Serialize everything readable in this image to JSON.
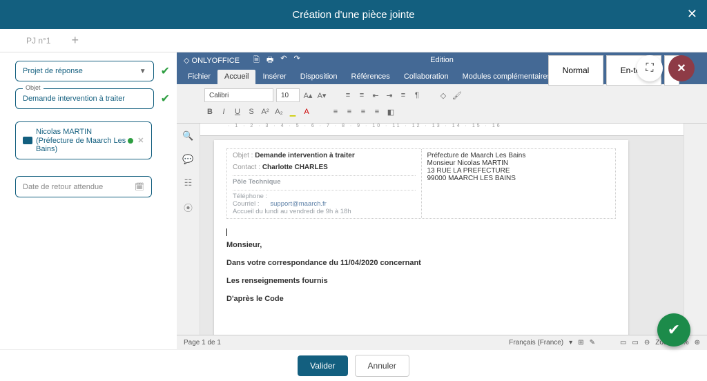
{
  "modal": {
    "title": "Création d'une pièce jointe"
  },
  "tabs": {
    "first": "PJ n°1"
  },
  "fields": {
    "type": "Projet de réponse",
    "object_label": "Objet",
    "object_value": "Demande intervention à traiter",
    "date_placeholder": "Date de retour attendue"
  },
  "contact": {
    "name": "Nicolas MARTIN",
    "org_prefix": "(Préfecture de Maarch Les",
    "org_suffix": "Bains)"
  },
  "onlyoffice": {
    "brand": "ONLYOFFICE",
    "center": "Edition",
    "menu": {
      "fichier": "Fichier",
      "accueil": "Accueil",
      "inserer": "Insérer",
      "disposition": "Disposition",
      "references": "Références",
      "collaboration": "Collaboration",
      "modules": "Modules complémentaires"
    },
    "font": {
      "name": "Calibri",
      "size": "10"
    },
    "styles": {
      "normal": "Normal",
      "entete": "En-tête"
    }
  },
  "doc": {
    "objet_label": "Objet :",
    "objet_value": "Demande intervention à traiter",
    "contact_label": "Contact :",
    "contact_value": "Charlotte CHARLES",
    "pole": "Pôle Technique",
    "tel": "Téléphone :",
    "mail_label": "Courriel :",
    "mail_value": "support@maarch.fr",
    "hours": "Accueil du lundi au vendredi de 9h à 18h",
    "addr1": "Préfecture de Maarch Les Bains",
    "addr2": "Monsieur Nicolas MARTIN",
    "addr3": "13 RUE LA PREFECTURE",
    "addr4": "99000 MAARCH LES BAINS",
    "p1": "Monsieur,",
    "p2": "Dans votre correspondance du 11/04/2020 concernant",
    "p3": "Les renseignements fournis",
    "p4": "D'après le Code"
  },
  "status": {
    "page": "Page 1 de 1",
    "lang": "Français (France)",
    "zoom": "Zoom 96%"
  },
  "footer": {
    "validate": "Valider",
    "cancel": "Annuler"
  }
}
